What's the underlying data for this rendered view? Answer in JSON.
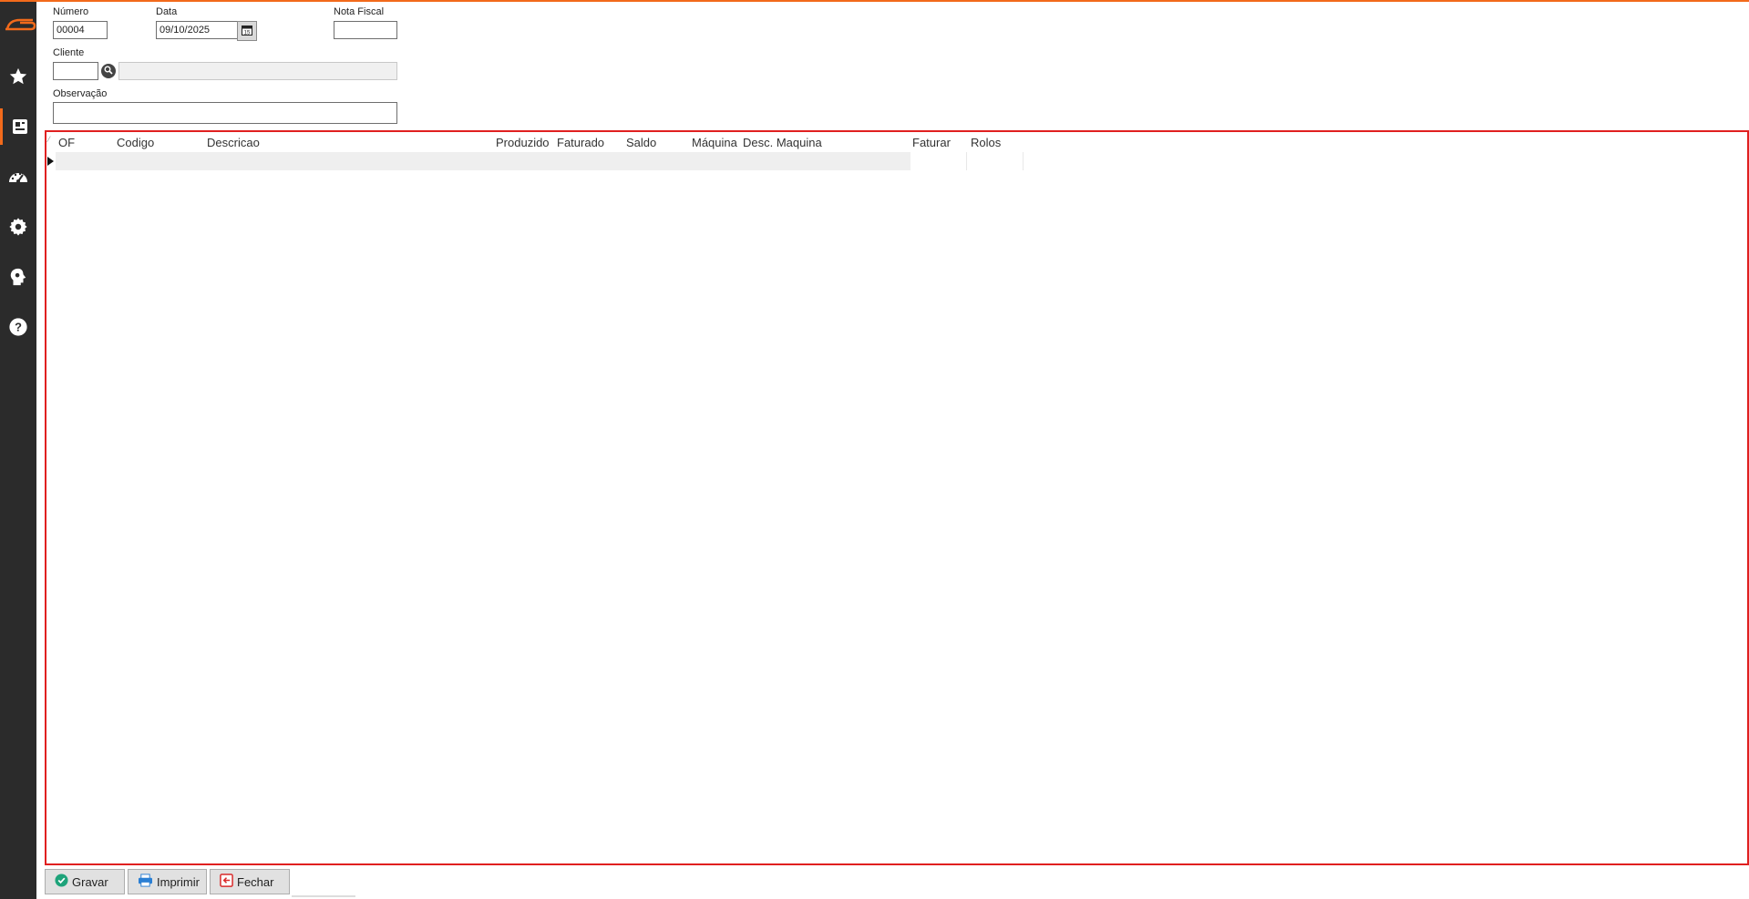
{
  "form": {
    "numero_label": "Número",
    "numero_value": "00004",
    "data_label": "Data",
    "data_value": "09/10/2025",
    "nota_label": "Nota Fiscal",
    "nota_value": "",
    "cliente_label": "Cliente",
    "cliente_code": "",
    "cliente_name": "",
    "obs_label": "Observação",
    "obs_value": ""
  },
  "grid": {
    "columns": [
      "OF",
      "Codigo",
      "Descricao",
      "Produzido",
      "Faturado",
      "Saldo",
      "Máquina",
      "Desc. Maquina",
      "Faturar",
      "Rolos"
    ]
  },
  "buttons": {
    "gravar": "Gravar",
    "imprimir": "Imprimir",
    "fechar": "Fechar"
  },
  "colors": {
    "accent": "#f26a1b",
    "grid_border": "#e02020",
    "sidebar": "#2b2b2b"
  },
  "sidebar_icons": [
    "logo-icon",
    "star-icon",
    "document-icon",
    "dashboard-icon",
    "gear-icon",
    "user-settings-icon",
    "help-icon"
  ]
}
